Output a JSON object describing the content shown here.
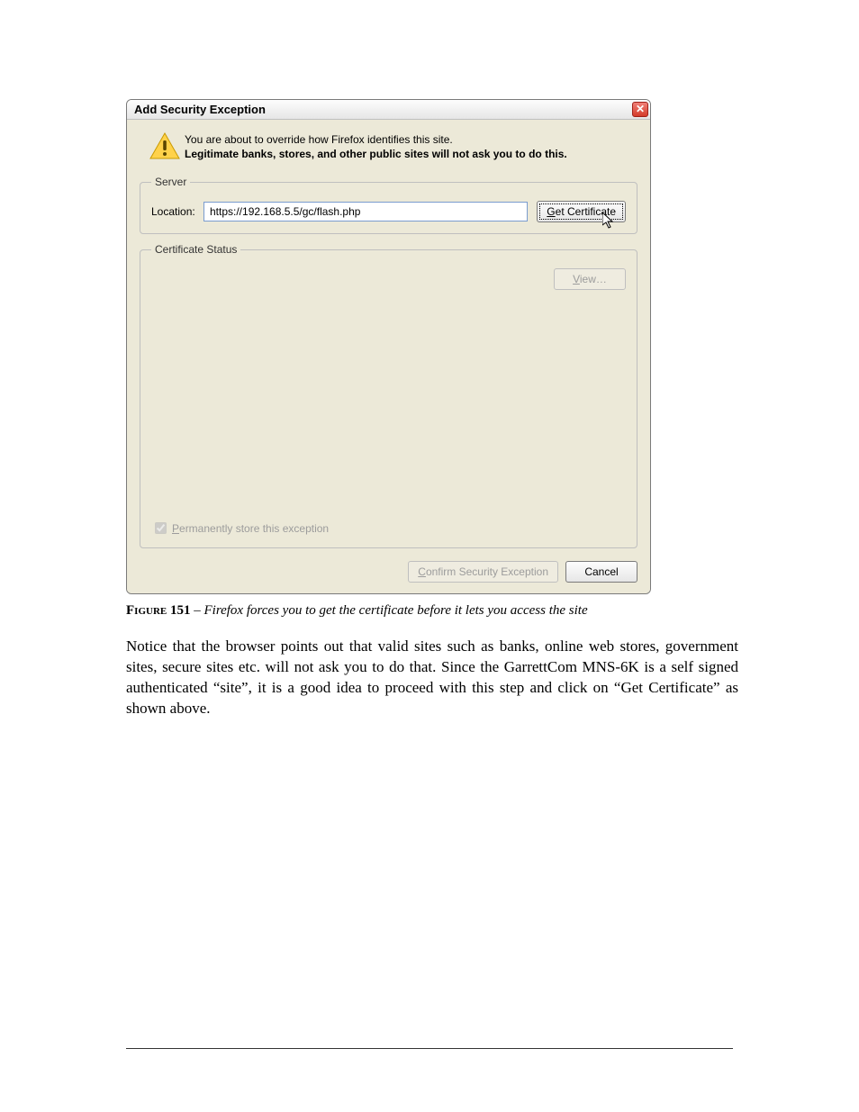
{
  "dialog": {
    "title": "Add Security Exception",
    "warning_line1": "You are about to override how Firefox identifies this site.",
    "warning_line2": "Legitimate banks, stores, and other public sites will not ask you to do this.",
    "server": {
      "legend": "Server",
      "location_label": "Location:",
      "location_value": "https://192.168.5.5/gc/flash.php",
      "get_cert_label": "Get Certificate"
    },
    "cert_status": {
      "legend": "Certificate Status",
      "view_label": "View…",
      "permanent_label": "Permanently store this exception",
      "permanent_checked": true
    },
    "actions": {
      "confirm_label": "Confirm Security Exception",
      "cancel_label": "Cancel"
    }
  },
  "caption": {
    "figure_label": "Figure 151",
    "separator": " – ",
    "text": "Firefox forces you to get the certificate before it lets you access the site"
  },
  "paragraph": "Notice that the browser points out that valid sites such as banks, online web stores, government sites, secure sites etc. will not ask you to do that. Since the GarrettCom MNS-6K is a self signed authenticated “site”, it is a good idea to proceed with this step and click on “Get Certificate” as shown above."
}
